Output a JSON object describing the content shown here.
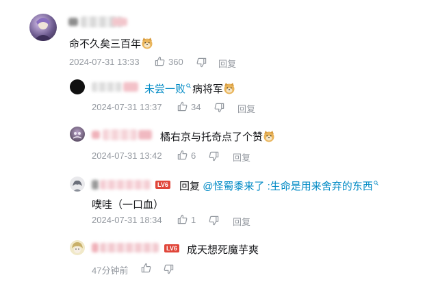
{
  "comments": [
    {
      "text": "命不久矣三百年",
      "time": "2024-07-31 13:33",
      "likes": "360",
      "reply": "回复"
    },
    {
      "mention": "未尝一败",
      "text": "病将军",
      "time": "2024-07-31 13:37",
      "likes": "34",
      "reply": "回复"
    },
    {
      "text": "橘右京与托奇点了个赞",
      "time": "2024-07-31 13:42",
      "likes": "6",
      "reply": "回复"
    },
    {
      "level": "LV6",
      "reply_prefix": "回复",
      "reply_to": "@怪蜀黍来了",
      "colon": ":",
      "quote": "生命是用来舍弃的东西",
      "text": "噗哇（一口血）",
      "time": "2024-07-31 18:34",
      "likes": "1",
      "reply": "回复"
    },
    {
      "level": "LV6",
      "text": "成天想死魔芋爽",
      "time": "47分钟前"
    }
  ],
  "colors": {
    "link": "#008ac5",
    "meta": "#9499a0",
    "level_badge": "#e0463a"
  }
}
